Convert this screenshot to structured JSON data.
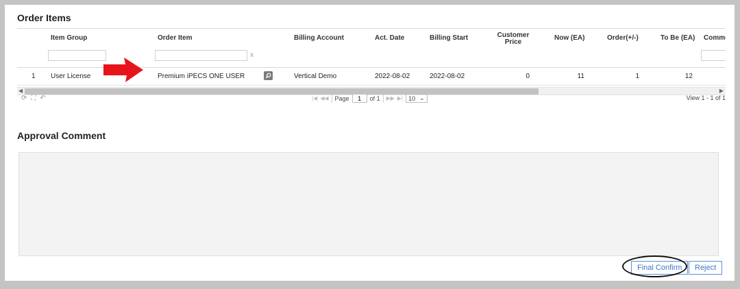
{
  "order_items": {
    "title": "Order Items",
    "columns": [
      "Item Group",
      "Order Item",
      "Billing Account",
      "Act. Date",
      "Billing Start",
      "Customer Price",
      "Now (EA)",
      "Order(+/-)",
      "To Be (EA)",
      "Comme"
    ],
    "customer_price_lines": [
      "Customer",
      "Price"
    ],
    "filter_clear": "x",
    "row": {
      "index": "1",
      "item_group": "User License",
      "order_item": "Premium iPECS ONE USER",
      "billing_account": "Vertical Demo",
      "act_date": "2022-08-02",
      "billing_start": "2022-08-02",
      "customer_price": "0",
      "now_ea": "11",
      "order_delta": "1",
      "to_be_ea": "12"
    },
    "pager": {
      "page_label": "Page",
      "page_value": "1",
      "of_label": "of 1",
      "rows_per_page": "10",
      "view_text": "View 1 - 1 of 1"
    }
  },
  "approval_comment": {
    "title": "Approval Comment",
    "value": ""
  },
  "actions": {
    "final_confirm": "Final Confirm",
    "reject": "Reject"
  },
  "colors": {
    "annotation_arrow": "#e8141b",
    "button_text": "#3a79c4"
  }
}
